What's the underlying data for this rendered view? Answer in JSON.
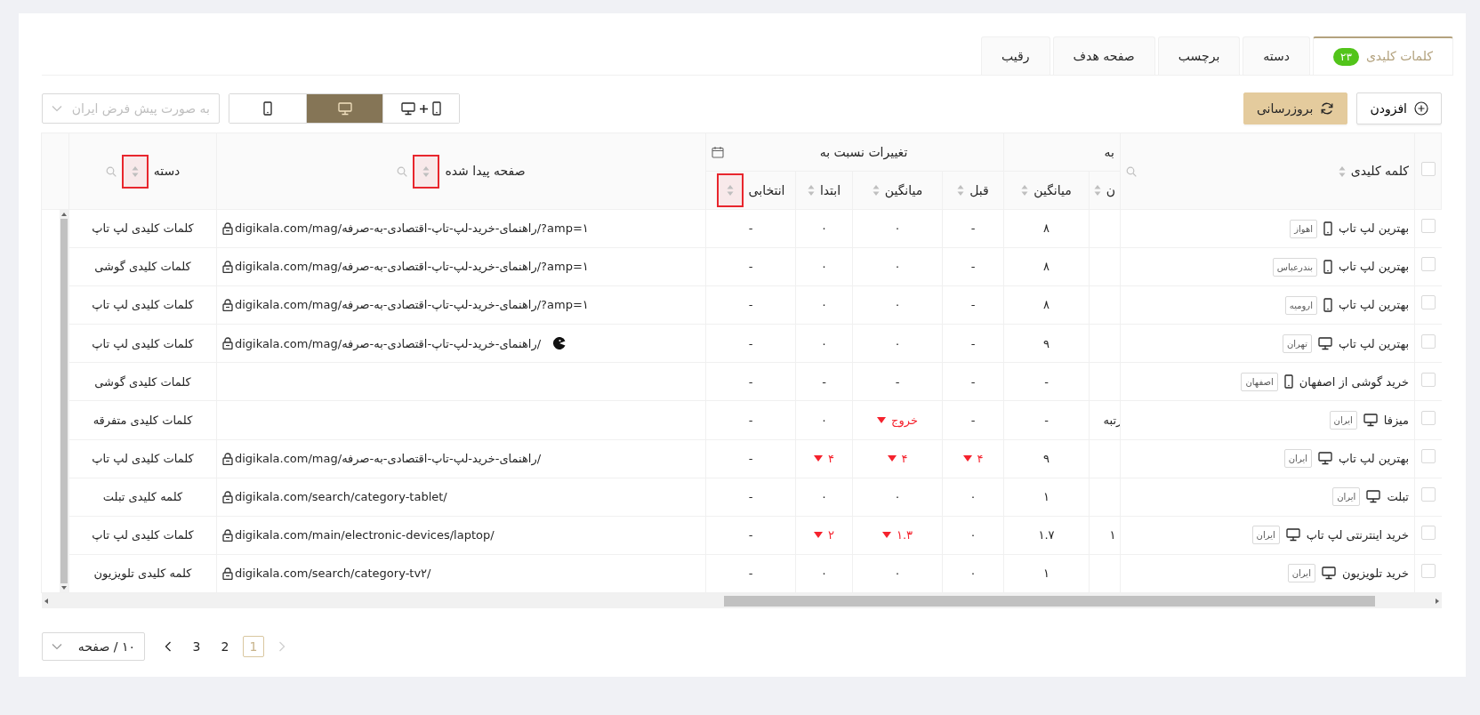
{
  "tabs": [
    {
      "label": "کلمات کلیدی",
      "count": "۲۳",
      "selected": true
    },
    {
      "label": "دسته",
      "selected": false
    },
    {
      "label": "برچسب",
      "selected": false
    },
    {
      "label": "صفحه هدف",
      "selected": false
    },
    {
      "label": "رقیب",
      "selected": false
    }
  ],
  "toolbar": {
    "add_button": "افزودن",
    "refresh_button": "بروزرسانی",
    "device_filter": [
      {
        "kind": "both",
        "selected": false
      },
      {
        "kind": "desktop",
        "selected": true
      },
      {
        "kind": "mobile",
        "selected": false
      }
    ],
    "region_select": {
      "placeholder": "به صورت پیش فرض ایران"
    }
  },
  "table": {
    "header": [
      {
        "kind": "check",
        "checked": false
      },
      {
        "kind": "column",
        "label": "کلمه کلیدی",
        "sortable": true,
        "searchable": true,
        "highlighted": false
      },
      {
        "kind": "group",
        "label": "به",
        "calendar": false,
        "children": [
          {
            "label": "ن",
            "sortable": true,
            "highlighted": false
          },
          {
            "label": "میانگین",
            "sortable": true,
            "highlighted": false
          }
        ]
      },
      {
        "kind": "group",
        "label": "تغییرات نسبت به",
        "calendar": true,
        "children": [
          {
            "label": "قبل",
            "sortable": true,
            "highlighted": false
          },
          {
            "label": "میانگین",
            "sortable": true,
            "highlighted": false
          },
          {
            "label": "ابتدا",
            "sortable": true,
            "highlighted": false
          },
          {
            "label": "انتخابی",
            "sortable": true,
            "highlighted": true
          }
        ]
      },
      {
        "kind": "column",
        "label": "صفحه پیدا شده",
        "sortable": true,
        "searchable": true,
        "highlighted": true
      },
      {
        "kind": "column",
        "label": "دسته",
        "sortable": true,
        "searchable": true,
        "highlighted": true
      },
      {
        "kind": "blank"
      }
    ],
    "rows": [
      {
        "checked": false,
        "keyword": "بهترین لپ تاپ",
        "kind": "mobile",
        "city": "اهواز",
        "cells": [
          {},
          {
            "text": "۸"
          },
          {
            "text": "-"
          },
          {
            "text": "۰"
          },
          {
            "text": "۰"
          },
          {
            "text": "-"
          }
        ],
        "page": {
          "url": "digikala.com/mag/راهنمای-خرید-لپ-تاپ-اقتصادی-به-صرفه/?amp=۱"
        },
        "category": "کلمات کلیدی لپ تاپ"
      },
      {
        "checked": false,
        "keyword": "بهترین لپ تاپ",
        "kind": "mobile",
        "city": "بندرعباس",
        "cells": [
          {},
          {
            "text": "۸"
          },
          {
            "text": "-"
          },
          {
            "text": "۰"
          },
          {
            "text": "۰"
          },
          {
            "text": "-"
          }
        ],
        "page": {
          "url": "digikala.com/mag/راهنمای-خرید-لپ-تاپ-اقتصادی-به-صرفه/?amp=۱"
        },
        "category": "کلمات کلیدی گوشی"
      },
      {
        "checked": false,
        "keyword": "بهترین لپ تاپ",
        "kind": "mobile",
        "city": "ارومیه",
        "cells": [
          {},
          {
            "text": "۸"
          },
          {
            "text": "-"
          },
          {
            "text": "۰"
          },
          {
            "text": "۰"
          },
          {
            "text": "-"
          }
        ],
        "page": {
          "url": "digikala.com/mag/راهنمای-خرید-لپ-تاپ-اقتصادی-به-صرفه/?amp=۱"
        },
        "category": "کلمات کلیدی لپ تاپ"
      },
      {
        "checked": false,
        "keyword": "بهترین لپ تاپ",
        "kind": "desktop",
        "city": "تهران",
        "cells": [
          {},
          {
            "text": "۹"
          },
          {
            "text": "-"
          },
          {
            "text": "۰"
          },
          {
            "text": "۰"
          },
          {
            "text": "-"
          }
        ],
        "page": {
          "url": "digikala.com/mag/راهنمای-خرید-لپ-تاپ-اقتصادی-به-صرفه/",
          "extra_icon": true
        },
        "category": "کلمات کلیدی لپ تاپ"
      },
      {
        "checked": false,
        "keyword": "خرید گوشی از اصفهان",
        "kind": "mobile",
        "city": "اصفهان",
        "cells": [
          {},
          {
            "text": "-"
          },
          {
            "text": "-"
          },
          {
            "text": "-"
          },
          {
            "text": "-"
          },
          {
            "text": "-"
          }
        ],
        "category": "کلمات کلیدی گوشی"
      },
      {
        "checked": false,
        "keyword": "میزفا",
        "kind": "desktop",
        "city": "ایران",
        "cells": [
          {
            "text": "رتبه"
          },
          {
            "text": "-"
          },
          {
            "text": "-"
          },
          {
            "text": "خروج",
            "down": true
          },
          {
            "text": "۰"
          },
          {
            "text": "-"
          }
        ],
        "category": "کلمات کلیدی متفرقه"
      },
      {
        "checked": false,
        "keyword": "بهترین لپ تاپ",
        "kind": "desktop",
        "city": "ایران",
        "cells": [
          {},
          {
            "text": "۹"
          },
          {
            "text": "۴",
            "down": true
          },
          {
            "text": "۴",
            "down": true
          },
          {
            "text": "۴",
            "down": true
          },
          {
            "text": "-"
          }
        ],
        "page": {
          "url": "digikala.com/mag/راهنمای-خرید-لپ-تاپ-اقتصادی-به-صرفه/"
        },
        "category": "کلمات کلیدی لپ تاپ"
      },
      {
        "checked": false,
        "keyword": "تبلت",
        "kind": "desktop",
        "city": "ایران",
        "cells": [
          {},
          {
            "text": "۱"
          },
          {
            "text": "۰"
          },
          {
            "text": "۰"
          },
          {
            "text": "۰"
          },
          {
            "text": "-"
          }
        ],
        "page": {
          "url": "digikala.com/search/category-tablet/"
        },
        "category": "کلمه کلیدی تبلت"
      },
      {
        "checked": false,
        "keyword": "خرید اینترنتی لپ تاپ",
        "kind": "desktop",
        "city": "ایران",
        "cells": [
          {
            "text": "۱"
          },
          {
            "text": "۱.۷"
          },
          {
            "text": "۰"
          },
          {
            "text": "۱.۳",
            "down": true
          },
          {
            "text": "۲",
            "down": true
          },
          {
            "text": "-"
          }
        ],
        "page": {
          "url": "digikala.com/main/electronic-devices/laptop/"
        },
        "category": "کلمات کلیدی لپ تاپ"
      },
      {
        "checked": false,
        "keyword": "خرید تلویزیون",
        "kind": "desktop",
        "city": "ایران",
        "cells": [
          {},
          {
            "text": "۱"
          },
          {
            "text": "۰"
          },
          {
            "text": "۰"
          },
          {
            "text": "۰"
          },
          {
            "text": "-"
          }
        ],
        "page": {
          "url": "digikala.com/search/category-tv۲/"
        },
        "category": "کلمه کلیدی تلویزیون"
      }
    ]
  },
  "pagination": {
    "pages": [
      {
        "label": "1",
        "selected": true
      },
      {
        "label": "2",
        "selected": false
      },
      {
        "label": "3",
        "selected": false
      }
    ],
    "prev_disabled": true,
    "next_disabled": false,
    "page_size": "۱۰ / صفحه"
  }
}
